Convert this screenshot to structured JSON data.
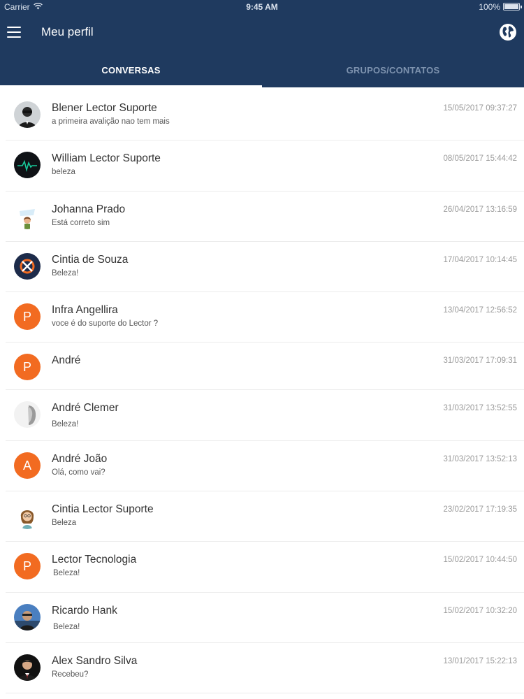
{
  "status_bar": {
    "carrier": "Carrier",
    "time": "9:45 AM",
    "battery": "100%"
  },
  "header": {
    "title": "Meu perfil",
    "menu_icon": "hamburger-menu-icon",
    "globe_icon": "globe-icon",
    "background": "#1f3a5f"
  },
  "tabs": [
    {
      "label": "CONVERSAS",
      "active": true
    },
    {
      "label": "GRUPOS/CONTATOS",
      "active": false
    }
  ],
  "colors": {
    "accent": "#f26b21",
    "header": "#1f3a5f",
    "tab_inactive": "#7e93af"
  },
  "conversations": [
    {
      "name": "Blener Lector Suporte",
      "message": "a primeira avalição nao tem mais",
      "date": "15/05/2017 09:37:27",
      "avatar": "photo"
    },
    {
      "name": "William Lector Suporte",
      "message": "beleza",
      "date": "08/05/2017 15:44:42",
      "avatar": "pulse"
    },
    {
      "name": "Johanna Prado",
      "message": "Está correto sim",
      "date": "26/04/2017 13:16:59",
      "avatar": "bye"
    },
    {
      "name": "Cintia de Souza",
      "message": "Beleza!",
      "date": "17/04/2017 10:14:45",
      "avatar": "logo"
    },
    {
      "name": "Infra Angellira",
      "message": "voce é do suporte do Lector ?",
      "date": "13/04/2017 12:56:52",
      "avatar": "letter",
      "letter": "P"
    },
    {
      "name": "André",
      "message": "",
      "date": "31/03/2017 17:09:31",
      "avatar": "letter",
      "letter": "P"
    },
    {
      "name": "André Clemer",
      "message": "Beleza!",
      "date": "31/03/2017 13:52:55",
      "avatar": "photo-gray"
    },
    {
      "name": "André João",
      "message": "Olá, como vai?",
      "date": "31/03/2017 13:52:13",
      "avatar": "letter",
      "letter": "A"
    },
    {
      "name": "Cintia Lector Suporte",
      "message": "Beleza",
      "date": "23/02/2017 17:19:35",
      "avatar": "cartoon"
    },
    {
      "name": "Lector Tecnologia",
      "message": "Beleza!",
      "date": "15/02/2017 10:44:50",
      "avatar": "letter",
      "letter": "P"
    },
    {
      "name": "Ricardo Hank",
      "message": "Beleza!",
      "date": "15/02/2017 10:32:20",
      "avatar": "photo-blue"
    },
    {
      "name": "Alex Sandro Silva",
      "message": "Recebeu?",
      "date": "13/01/2017 15:22:13",
      "avatar": "photo-suit"
    }
  ]
}
